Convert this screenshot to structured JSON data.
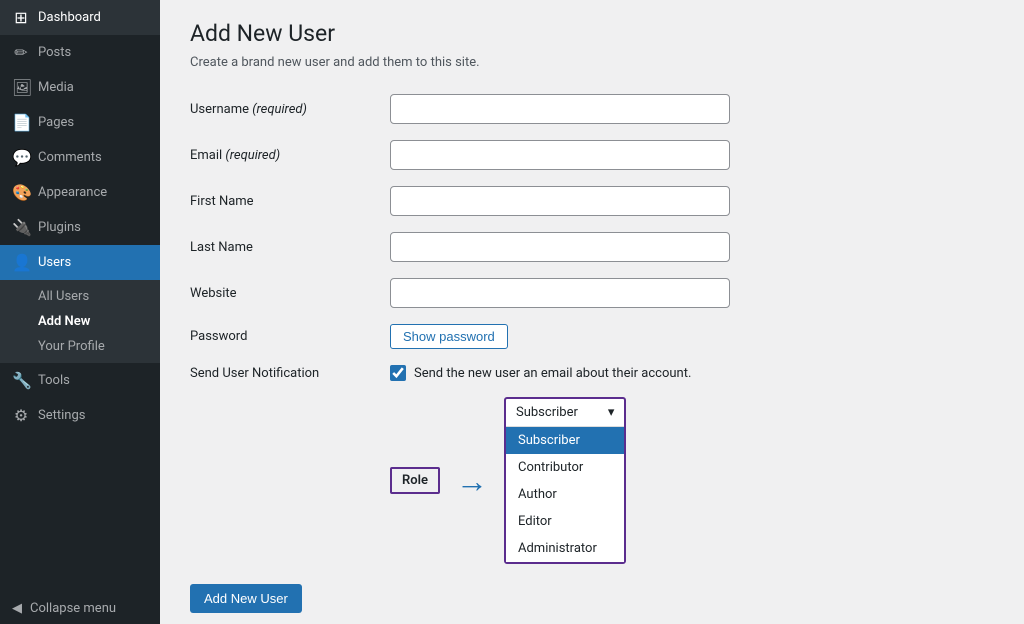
{
  "sidebar": {
    "items": [
      {
        "id": "dashboard",
        "label": "Dashboard",
        "icon": "⊞"
      },
      {
        "id": "posts",
        "label": "Posts",
        "icon": "✏"
      },
      {
        "id": "media",
        "label": "Media",
        "icon": "🖼"
      },
      {
        "id": "pages",
        "label": "Pages",
        "icon": "📄"
      },
      {
        "id": "comments",
        "label": "Comments",
        "icon": "💬"
      },
      {
        "id": "appearance",
        "label": "Appearance",
        "icon": "🎨"
      },
      {
        "id": "plugins",
        "label": "Plugins",
        "icon": "🔌"
      },
      {
        "id": "users",
        "label": "Users",
        "icon": "👤"
      },
      {
        "id": "tools",
        "label": "Tools",
        "icon": "🔧"
      },
      {
        "id": "settings",
        "label": "Settings",
        "icon": "⚙"
      }
    ],
    "users_submenu": [
      {
        "id": "all-users",
        "label": "All Users"
      },
      {
        "id": "add-new",
        "label": "Add New",
        "active": true
      },
      {
        "id": "your-profile",
        "label": "Your Profile"
      }
    ],
    "collapse_label": "Collapse menu"
  },
  "page": {
    "title": "Add New User",
    "subtitle": "Create a brand new user and add them to this site."
  },
  "form": {
    "username_label": "Username",
    "username_required": "(required)",
    "username_placeholder": "",
    "email_label": "Email",
    "email_required": "(required)",
    "email_placeholder": "",
    "firstname_label": "First Name",
    "firstname_placeholder": "",
    "lastname_label": "Last Name",
    "lastname_placeholder": "",
    "website_label": "Website",
    "website_placeholder": "",
    "password_label": "Password",
    "show_password_btn": "Show password",
    "notification_label": "Send User Notification",
    "notification_text": "Send the new user an email about their account.",
    "role_label": "Role",
    "role_arrow": "→",
    "role_selected": "Subscriber",
    "role_options": [
      {
        "id": "subscriber",
        "label": "Subscriber",
        "selected": true
      },
      {
        "id": "contributor",
        "label": "Contributor"
      },
      {
        "id": "author",
        "label": "Author"
      },
      {
        "id": "editor",
        "label": "Editor"
      },
      {
        "id": "administrator",
        "label": "Administrator"
      }
    ],
    "add_user_btn": "Add New User"
  }
}
